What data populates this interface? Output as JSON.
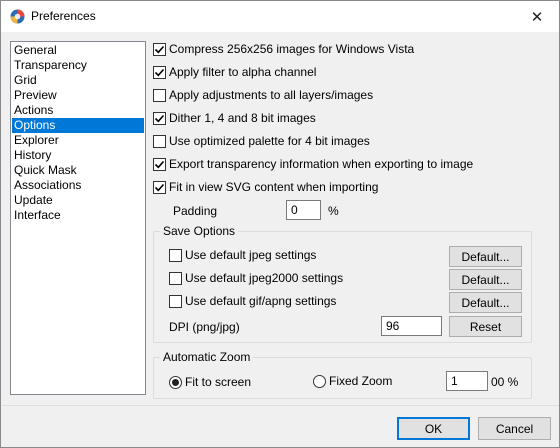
{
  "window": {
    "title": "Preferences",
    "close_symbol": "✕",
    "icon": "app-logo-icon"
  },
  "nav": {
    "items": [
      {
        "label": "General",
        "selected": false
      },
      {
        "label": "Transparency",
        "selected": false
      },
      {
        "label": "Grid",
        "selected": false
      },
      {
        "label": "Preview",
        "selected": false
      },
      {
        "label": "Actions",
        "selected": false
      },
      {
        "label": "Options",
        "selected": true
      },
      {
        "label": "Explorer",
        "selected": false
      },
      {
        "label": "History",
        "selected": false
      },
      {
        "label": "Quick Mask",
        "selected": false
      },
      {
        "label": "Associations",
        "selected": false
      },
      {
        "label": "Update",
        "selected": false
      },
      {
        "label": "Interface",
        "selected": false
      }
    ]
  },
  "options": {
    "checkboxes": [
      {
        "label": "Compress 256x256 images for Windows Vista",
        "checked": true
      },
      {
        "label": "Apply filter to alpha channel",
        "checked": true
      },
      {
        "label": "Apply adjustments to all layers/images",
        "checked": false
      },
      {
        "label": "Dither 1, 4 and 8 bit images",
        "checked": true
      },
      {
        "label": "Use optimized palette for 4 bit images",
        "checked": false
      },
      {
        "label": "Export transparency information when exporting to image",
        "checked": true
      },
      {
        "label": "Fit in view SVG content when importing",
        "checked": true
      }
    ],
    "padding": {
      "label": "Padding",
      "value": "0",
      "unit": "%"
    }
  },
  "save_options": {
    "title": "Save Options",
    "rows": [
      {
        "label": "Use default jpeg settings",
        "checked": false,
        "button": "Default..."
      },
      {
        "label": "Use default jpeg2000 settings",
        "checked": false,
        "button": "Default..."
      },
      {
        "label": "Use default gif/apng settings",
        "checked": false,
        "button": "Default..."
      }
    ],
    "dpi": {
      "label": "DPI (png/jpg)",
      "value": "96",
      "button": "Reset"
    }
  },
  "auto_zoom": {
    "title": "Automatic Zoom",
    "fit_to_screen": {
      "label": "Fit to screen",
      "selected": true
    },
    "fixed_zoom": {
      "label": "Fixed Zoom",
      "selected": false
    },
    "zoom_value": "1",
    "zoom_unit": "00 %"
  },
  "footer": {
    "ok_label": "OK",
    "cancel_label": "Cancel"
  }
}
